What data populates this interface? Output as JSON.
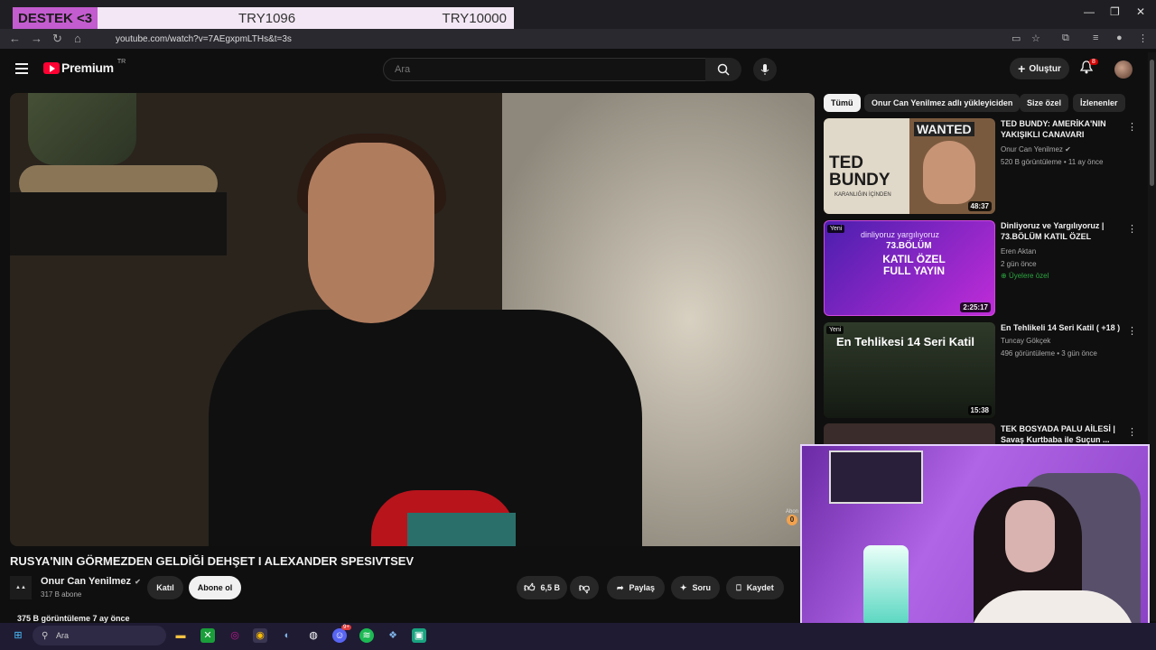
{
  "browser": {
    "url": "youtube.com/watch?v=7AEgxpmLTHs&t=3s",
    "donation": {
      "label": "DESTEK <3",
      "amount1": "TRY1096",
      "amount2": "TRY10000"
    }
  },
  "header": {
    "logo_text": "Premium",
    "country": "TR",
    "search_placeholder": "Ara",
    "create_label": "Oluştur",
    "notifications_count": "8"
  },
  "video": {
    "title": "RUSYA'NIN GÖRMEZDEN GELDİĞİ DEHŞET I ALEXANDER SPESIVTSEV",
    "channel": "Onur Can Yenilmez",
    "subscribers": "317 B abone",
    "join_label": "Katıl",
    "subscribe_label": "Abone ol",
    "likes": "6,5 B",
    "share_label": "Paylaş",
    "ask_label": "Soru",
    "save_label": "Kaydet",
    "meta": "375 B görüntüleme  7 ay önce",
    "side_label": "Abon",
    "side_count": "0"
  },
  "chips": [
    "Tümü",
    "Onur Can Yenilmez adlı yükleyiciden",
    "Size özel",
    "İzlenenler"
  ],
  "recommendations": [
    {
      "title": "TED BUNDY: AMERİKA'NIN YAKIŞIKLI CANAVARI",
      "channel": "Onur Can Yenilmez",
      "meta": "520 B görüntüleme • 11 ay önce",
      "duration": "48:37",
      "thumb_text": "TED BUNDY",
      "thumb_sub": "KARANLIĞIN İÇİNDEN",
      "thumb_top": "WANTED"
    },
    {
      "title": "Dinliyoruz ve Yargılıyoruz | 73.BÖLÜM KATIL ÖZEL",
      "channel": "Eren Aktan",
      "meta": "2 gün önce",
      "member": "Üyelere özel",
      "duration": "2:25:17",
      "badge": "Yeni",
      "thumb_text": "KATIL ÖZEL FULL YAYIN",
      "thumb_sub": "73.BÖLÜM",
      "thumb_top": "dinliyoruz yargılıyoruz"
    },
    {
      "title": "En Tehlikeli 14 Seri Katil ( +18 )",
      "channel": "Tuncay Gökçek",
      "meta": "496 görüntüleme • 3 gün önce",
      "duration": "15:38",
      "badge": "Yeni",
      "thumb_text": "En Tehlikesi 14 Seri Katil"
    },
    {
      "title": "TEK BOSYADA PALU AİLESİ | Savaş Kurtbaba ile Suçun ..."
    }
  ],
  "taskbar": {
    "search": "Ara",
    "discord_badge": "9+"
  },
  "colors": {
    "brand": "#ff0033",
    "member_green": "#2ba640",
    "donation_accent": "#c35ccf"
  }
}
